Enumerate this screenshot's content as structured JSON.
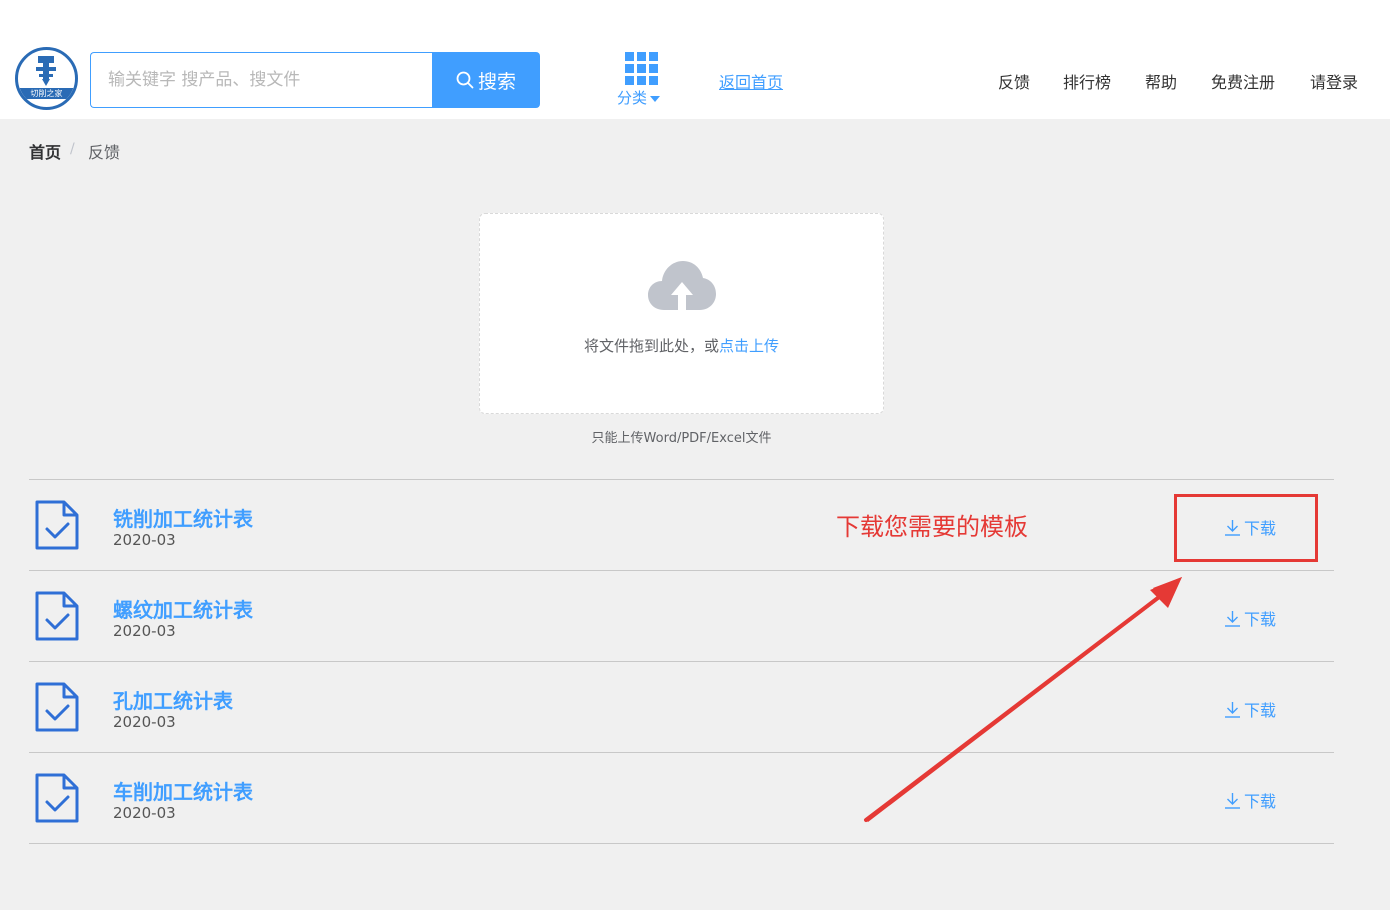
{
  "header": {
    "logo_text": "切削之家",
    "search": {
      "placeholder": "输关键字 搜产品、搜文件",
      "value": "",
      "button_label": "搜索"
    },
    "category_label": "分类",
    "home_link": "返回首页",
    "nav": [
      "反馈",
      "排行榜",
      "帮助",
      "免费注册",
      "请登录"
    ]
  },
  "breadcrumb": {
    "home": "首页",
    "separator": "/",
    "current": "反馈"
  },
  "upload": {
    "text": "将文件拖到此处，或",
    "link": "点击上传",
    "tip": "只能上传Word/PDF/Excel文件"
  },
  "files": [
    {
      "title": "铣削加工统计表",
      "date": "2020-03",
      "download_label": "下载"
    },
    {
      "title": "螺纹加工统计表",
      "date": "2020-03",
      "download_label": "下载"
    },
    {
      "title": "孔加工统计表",
      "date": "2020-03",
      "download_label": "下载"
    },
    {
      "title": "车削加工统计表",
      "date": "2020-03",
      "download_label": "下载"
    }
  ],
  "annotation": {
    "text": "下载您需要的模板",
    "color": "#e53935"
  },
  "colors": {
    "accent": "#409eff",
    "background": "#f0f0f0",
    "annotation_red": "#e53935"
  }
}
